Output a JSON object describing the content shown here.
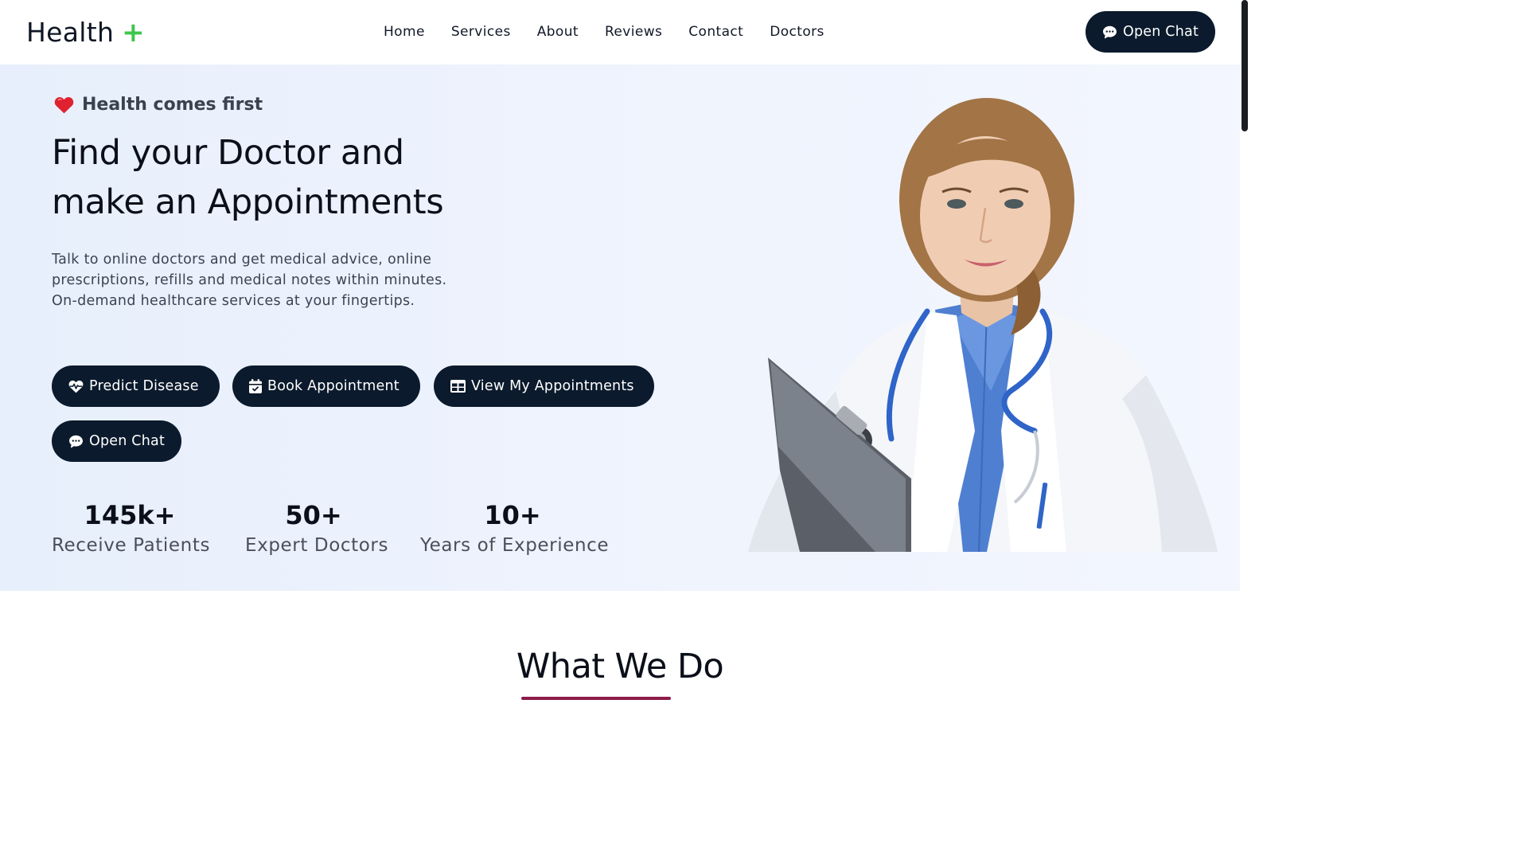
{
  "header": {
    "logo_text": "Health",
    "logo_plus": "+",
    "nav": [
      "Home",
      "Services",
      "About",
      "Reviews",
      "Contact",
      "Doctors"
    ],
    "cta_label": "Open Chat"
  },
  "hero": {
    "tagline": "Health comes first",
    "headline_line1": "Find your Doctor and",
    "headline_line2": "make an Appointments",
    "description": "Talk to online doctors and get medical advice, online prescriptions, refills and medical notes within minutes. On-demand healthcare services at your fingertips.",
    "buttons": {
      "predict": "Predict Disease",
      "book": "Book Appointment",
      "view": "View My Appointments",
      "chat": "Open Chat"
    },
    "stats": [
      {
        "value": "145k+",
        "label": "Receive Patients"
      },
      {
        "value": "50+",
        "label": "Expert Doctors"
      },
      {
        "value": "10+",
        "label": "Years of Experience"
      }
    ]
  },
  "section": {
    "title": "What We Do"
  },
  "colors": {
    "primary_dark": "#0b1a2c",
    "accent_green": "#3ec64a",
    "underline": "#8d1c4a",
    "hero_bg": "#eef3fd"
  },
  "icons": {
    "tagline": "heart-icon",
    "predict": "heart-pulse-icon",
    "book": "calendar-icon",
    "view": "table-icon",
    "chat": "chat-bubble-icon"
  }
}
